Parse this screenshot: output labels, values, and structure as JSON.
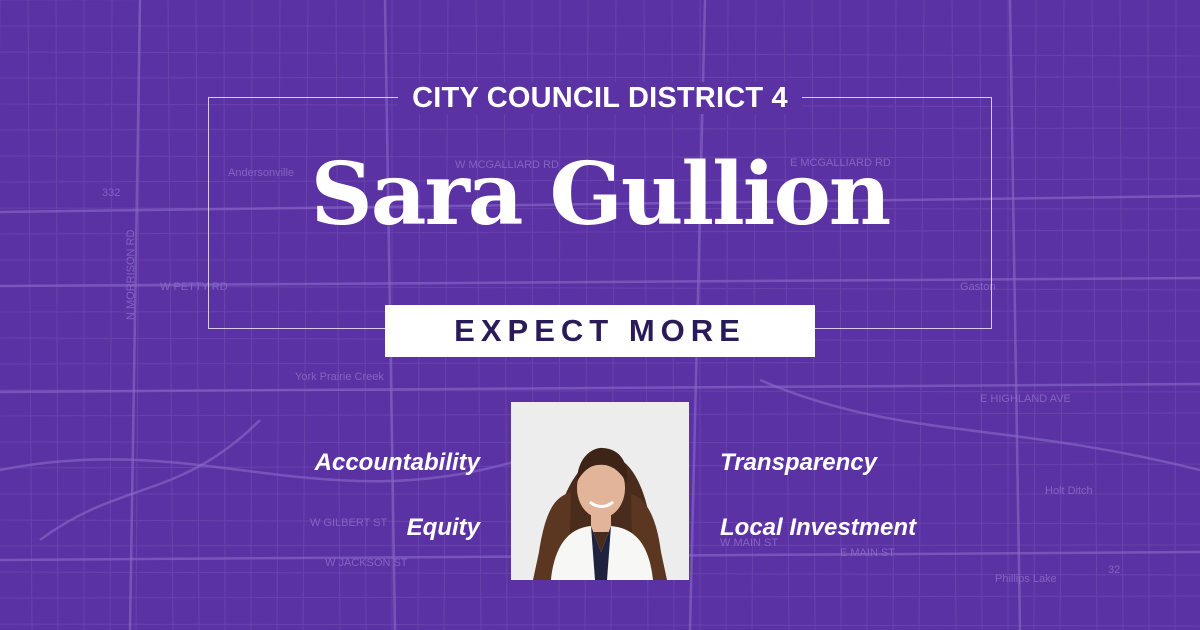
{
  "district_label": "CITY COUNCIL DISTRICT 4",
  "candidate_name": "Sara Gullion",
  "tagline": "EXPECT MORE",
  "values_left": [
    "Accountability",
    "Equity"
  ],
  "values_right": [
    "Transparency",
    "Local Investment"
  ],
  "photo": {
    "icon": "candidate-portrait"
  },
  "map_labels": {
    "road_1": "W MCGALLIARD RD",
    "road_2": "E MCGALLIARD RD",
    "road_3": "W PETTY RD",
    "road_4": "N MORRISON RD",
    "road_5": "York Prairie Creek",
    "road_6": "E HIGHLAND AVE",
    "road_7": "W GILBERT ST",
    "road_8": "W JACKSON ST",
    "road_9": "W MAIN ST",
    "road_10": "E MAIN ST",
    "road_11": "Phillips Lake",
    "road_12": "Holt Ditch",
    "road_13": "Andersonville",
    "road_14": "Gaston",
    "road_15": "332",
    "road_16": "32"
  },
  "colors": {
    "background": "#5b32a3",
    "map_lines": "#7b58bd",
    "tagline_text": "#2b1a58",
    "text": "#ffffff"
  }
}
